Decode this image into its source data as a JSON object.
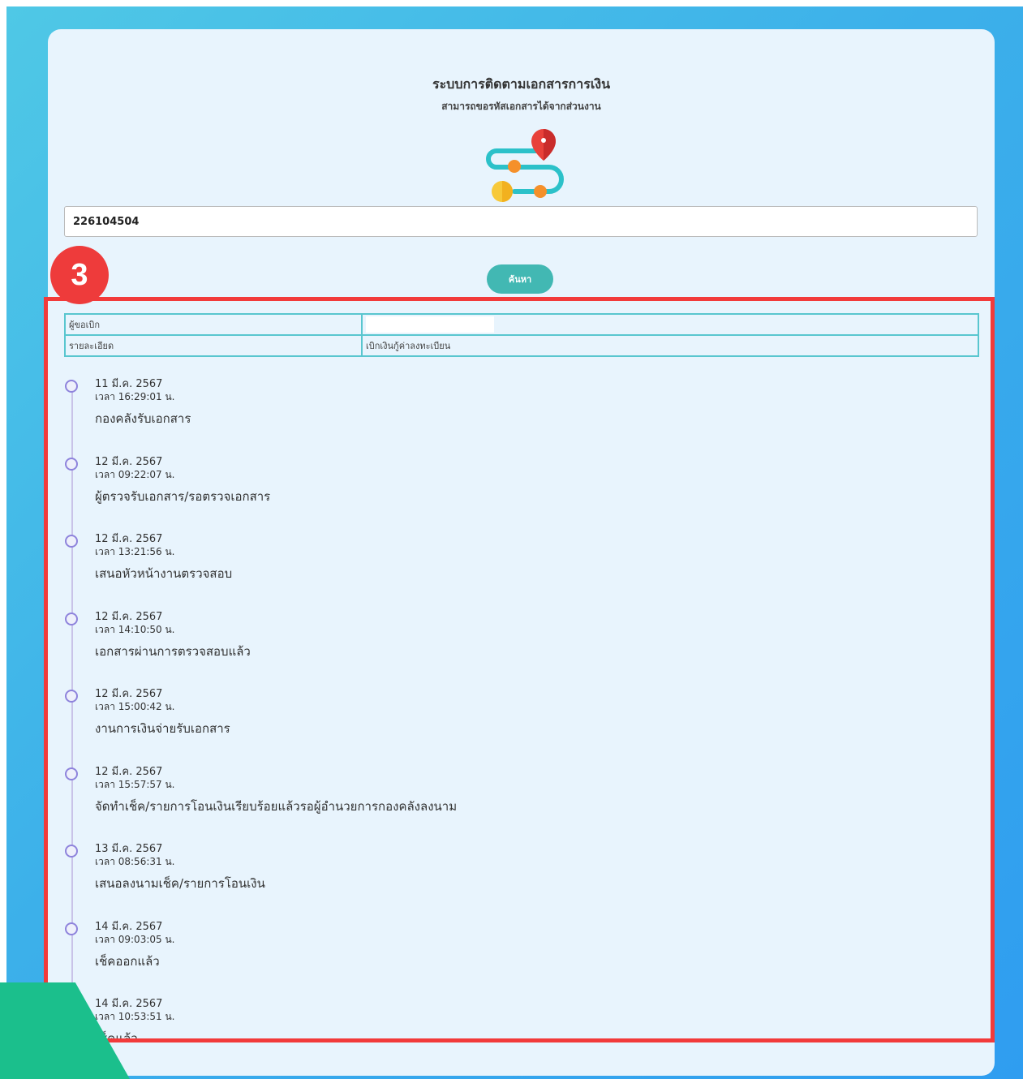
{
  "header": {
    "title": "ระบบการติดตามเอกสารการเงิน",
    "subtitle": "สามารถขอรหัสเอกสารได้จากส่วนงาน"
  },
  "search": {
    "value": "226104504",
    "button_label": "ค้นหา"
  },
  "info": {
    "requester_label": "ผู้ขอเบิก",
    "requester_value": "",
    "detail_label": "รายละเอียด",
    "detail_value": "เบิกเงินกู้ค่าลงทะเบียน"
  },
  "timeline": [
    {
      "date": "11 มี.ค. 2567",
      "time": "เวลา 16:29:01 น.",
      "status": "กองคลังรับเอกสาร"
    },
    {
      "date": "12 มี.ค. 2567",
      "time": "เวลา 09:22:07 น.",
      "status": "ผู้ตรวจรับเอกสาร/รอตรวจเอกสาร"
    },
    {
      "date": "12 มี.ค. 2567",
      "time": "เวลา 13:21:56 น.",
      "status": "เสนอหัวหน้างานตรวจสอบ"
    },
    {
      "date": "12 มี.ค. 2567",
      "time": "เวลา 14:10:50 น.",
      "status": "เอกสารผ่านการตรวจสอบแล้ว"
    },
    {
      "date": "12 มี.ค. 2567",
      "time": "เวลา 15:00:42 น.",
      "status": "งานการเงินจ่ายรับเอกสาร"
    },
    {
      "date": "12 มี.ค. 2567",
      "time": "เวลา 15:57:57 น.",
      "status": "จัดทำเช็ค/รายการโอนเงินเรียบร้อยแล้วรอผู้อำนวยการกองคลังลงนาม"
    },
    {
      "date": "13 มี.ค. 2567",
      "time": "เวลา 08:56:31 น.",
      "status": "เสนอลงนามเช็ค/รายการโอนเงิน"
    },
    {
      "date": "14 มี.ค. 2567",
      "time": "เวลา 09:03:05 น.",
      "status": "เช็คออกแล้ว"
    },
    {
      "date": "14 มี.ค. 2567",
      "time": "เวลา 10:53:51 น.",
      "status": "เช็คแล้ว"
    }
  ],
  "annotation": {
    "step_number": "3",
    "highlight_color": "#f23a3a"
  },
  "colors": {
    "button": "#42b8b3",
    "table_border": "#59c6cf",
    "timeline_dot": "#8e83dc"
  }
}
